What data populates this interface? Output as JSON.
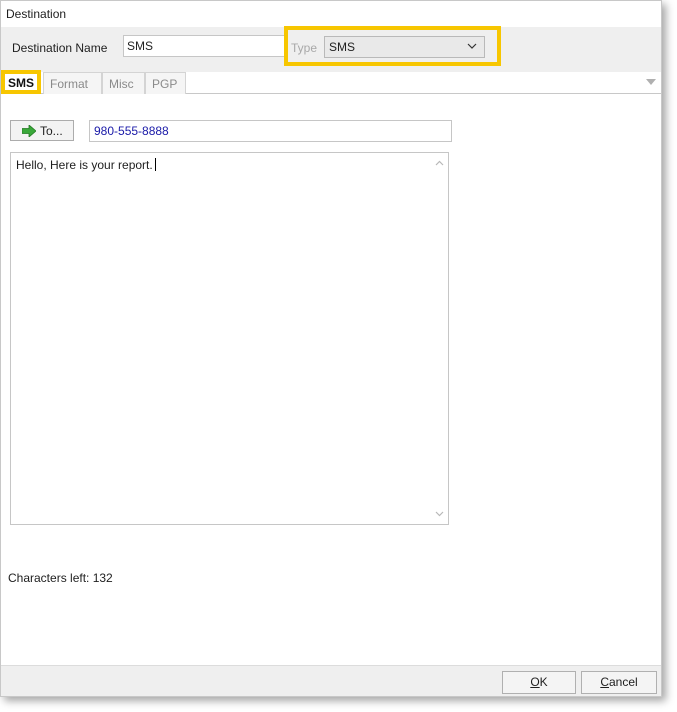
{
  "window": {
    "title": "Destination"
  },
  "header": {
    "destination_name_label": "Destination Name",
    "destination_name_value": "SMS",
    "type_label": "Type",
    "type_selected": "SMS"
  },
  "tabs": [
    {
      "label": "SMS",
      "active": true
    },
    {
      "label": "Format",
      "active": false
    },
    {
      "label": "Misc",
      "active": false
    },
    {
      "label": "PGP",
      "active": false
    }
  ],
  "sms": {
    "to_button_label": "To...",
    "to_value": "980-555-8888",
    "message": "Hello, Here is your report.",
    "characters_left_label": "Characters left: 132"
  },
  "footer": {
    "ok_label": "OK",
    "ok_mnemonic": "O",
    "ok_rest": "K",
    "cancel_label": "Cancel",
    "cancel_mnemonic": "C",
    "cancel_rest": "ancel"
  },
  "colors": {
    "highlight": "#f7c600",
    "to_value_text": "#1a1aa8",
    "arrow_icon": "#3aa83a"
  }
}
